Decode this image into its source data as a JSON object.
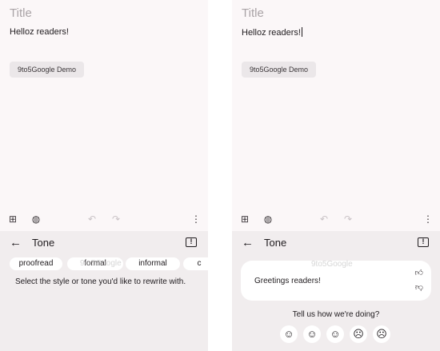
{
  "left": {
    "note": {
      "title_placeholder": "Title",
      "body": "Helloz readers!",
      "label": "9to5Google Demo"
    },
    "sheet": {
      "title": "Tone",
      "chips": [
        "proofread",
        "formal",
        "informal",
        "c"
      ],
      "watermark": "9to5Google",
      "instruction": "Select the style or tone you'd like to rewrite with."
    }
  },
  "right": {
    "note": {
      "title_placeholder": "Title",
      "body": "Helloz readers!",
      "label": "9to5Google Demo"
    },
    "sheet": {
      "title": "Tone",
      "watermark": "9to5Google",
      "suggestion": "Greetings readers!",
      "feedback_prompt": "Tell us how we're doing?"
    }
  },
  "icons": {
    "add_box": "add-box-icon",
    "palette": "palette-icon",
    "undo": "undo-icon",
    "redo": "redo-icon",
    "more": "more-vert-icon",
    "back": "arrow-back-icon",
    "feedback": "feedback-icon",
    "thumb_up": "thumb-up-icon",
    "thumb_down": "thumb-down-icon",
    "faces": [
      "very-happy-face-icon",
      "happy-face-icon",
      "neutral-face-icon",
      "sad-face-icon",
      "very-sad-face-icon"
    ]
  }
}
